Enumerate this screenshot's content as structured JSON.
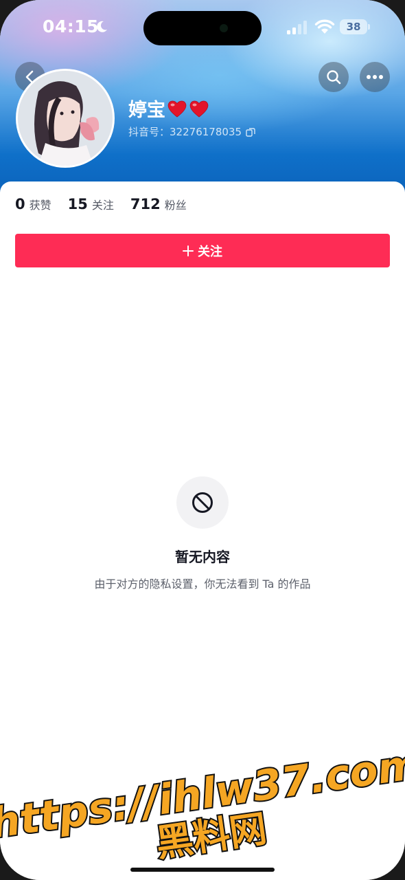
{
  "status_bar": {
    "time": "04:15",
    "battery": "38",
    "icons": [
      "moon-icon",
      "signal-icon",
      "wifi-icon",
      "battery-icon"
    ]
  },
  "nav": {
    "back_icon": "chevron-left-icon",
    "search_icon": "search-icon",
    "more_icon": "more-icon"
  },
  "profile": {
    "nickname": "婷宝",
    "nickname_hearts": [
      "heart-icon",
      "heart-icon"
    ],
    "id_label": "抖音号：",
    "id_value": "32276178035",
    "copy_icon": "copy-icon"
  },
  "stats": [
    {
      "value": "0",
      "label": "获赞"
    },
    {
      "value": "15",
      "label": "关注"
    },
    {
      "value": "712",
      "label": "粉丝"
    }
  ],
  "follow_button": {
    "label": "关注",
    "icon": "plus-icon",
    "color": "#fe2c55"
  },
  "empty_state": {
    "icon": "prohibited-icon",
    "title": "暂无内容",
    "description": "由于对方的隐私设置，你无法看到 Ta 的作品"
  },
  "watermark": {
    "line1": "https://ihlw37.com",
    "line2": "黑料网",
    "color": "#f5a623"
  }
}
